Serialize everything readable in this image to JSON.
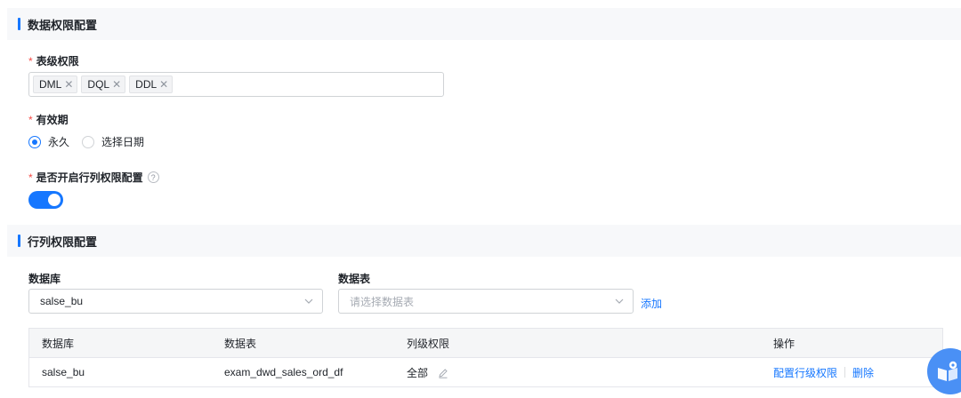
{
  "section_data_perm": {
    "title": "数据权限配置"
  },
  "table_perm": {
    "label": "表级权限",
    "required_mark": "*",
    "tags": [
      {
        "label": "DML",
        "remove": "✕"
      },
      {
        "label": "DQL",
        "remove": "✕"
      },
      {
        "label": "DDL",
        "remove": "✕"
      }
    ]
  },
  "validity": {
    "label": "有效期",
    "required_mark": "*",
    "options": [
      {
        "label": "永久",
        "checked": true
      },
      {
        "label": "选择日期",
        "checked": false
      }
    ]
  },
  "row_col_toggle": {
    "label": "是否开启行列权限配置",
    "required_mark": "*",
    "help": "?",
    "enabled": true
  },
  "section_row_col": {
    "title": "行列权限配置"
  },
  "filters": {
    "database_label": "数据库",
    "database_value": "salse_bu",
    "table_label": "数据表",
    "table_placeholder": "请选择数据表",
    "add_label": "添加"
  },
  "table": {
    "headers": [
      "数据库",
      "数据表",
      "列级权限",
      "操作"
    ],
    "rows": [
      {
        "database": "salse_bu",
        "table": "exam_dwd_sales_ord_df",
        "column_perm": "全部",
        "actions": [
          "配置行级权限",
          "删除"
        ]
      }
    ]
  },
  "colors": {
    "accent": "#1677ff",
    "required": "#f54a45"
  }
}
